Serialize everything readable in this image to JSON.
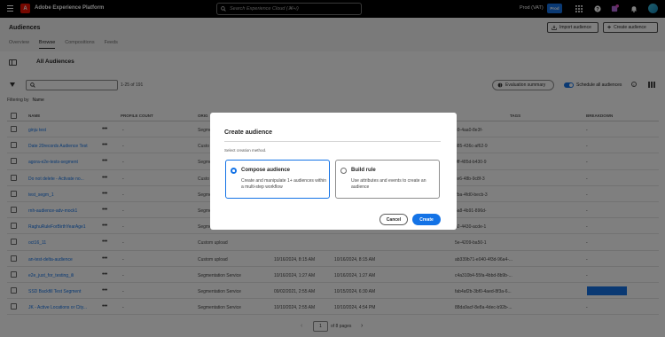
{
  "topbar": {
    "app_title": "Adobe Experience Platform",
    "search_placeholder": "Search Experience Cloud (⌘+/)",
    "org_name": "Prod (VAT)",
    "sandbox": "Prod"
  },
  "header": {
    "title": "Audiences",
    "import_label": "Import audience",
    "create_label": "Create audience",
    "tabs": [
      "Overview",
      "Browse",
      "Compositions",
      "Feeds"
    ],
    "active_tab": "Browse"
  },
  "toolbar": {
    "section_title": "All Audiences",
    "search_value": "",
    "count": "1-25 of 191",
    "eval_label": "Evaluation summary",
    "schedule_label": "Schedule all audiences",
    "filtering_label": "Filtering by",
    "filtering_value": "Name"
  },
  "table": {
    "columns": {
      "name": "NAME",
      "profile_count": "PROFILE COUNT",
      "origin": "ORIG",
      "tags": "TAGS",
      "breakdown": "BREAKDOWN"
    },
    "rows": [
      {
        "name": "ginju test",
        "pc": "-",
        "origin": "Segme",
        "created": "",
        "updated": "",
        "id": "e9-4aa0-8e3f-",
        "bd": "-",
        "bar": false
      },
      {
        "name": "Date 20records Audience Test",
        "pc": "-",
        "origin": "Custo",
        "created": "",
        "updated": "",
        "id": "385-436c-af62-9",
        "bd": "-",
        "bar": false
      },
      {
        "name": "agora-e2e-tests-segment",
        "pc": "-",
        "origin": "Segme",
        "created": "",
        "updated": "",
        "id": "0ff-485d-b430-9",
        "bd": "-",
        "bar": false
      },
      {
        "name": "Do not delete - Activate no...",
        "pc": "-",
        "origin": "Custo",
        "created": "",
        "updated": "",
        "id": "ce6-48b-9c8f-3",
        "bd": "-",
        "bar": false
      },
      {
        "name": "test_segm_1",
        "pc": "-",
        "origin": "Segme",
        "created": "",
        "updated": "",
        "id": "2ba-4fd0-becb-3",
        "bd": "-",
        "bar": false
      },
      {
        "name": "rnh-audience-adv-mock1",
        "pc": "-",
        "origin": "Segme",
        "created": "",
        "updated": "",
        "id": "5a8-4b91-896d-",
        "bd": "-",
        "bar": false
      },
      {
        "name": "RaghuRuleForBirthYearAge1",
        "pc": "-",
        "origin": "Segme",
        "created": "",
        "updated": "",
        "id": "b2-4430-acde-1",
        "bd": "-",
        "bar": false
      },
      {
        "name": "oct16_11",
        "pc": "-",
        "origin": "Custom upload",
        "created": "",
        "updated": "",
        "id": "5e-4209-ba50-1",
        "bd": "-",
        "bar": false
      },
      {
        "name": "an-test-delta-audience",
        "pc": "-",
        "origin": "Custom upload",
        "created": "10/16/2024, 8:15 AM",
        "updated": "10/16/2024, 8:15 AM",
        "id": "ab339b71-e040-4f3d-96a4-...",
        "bd": "-",
        "bar": false
      },
      {
        "name": "e2e_just_for_testing_ili",
        "pc": "-",
        "origin": "Segmentation Service",
        "created": "10/16/2024, 1:27 AM",
        "updated": "10/16/2024, 1:27 AM",
        "id": "c4a310b4-55fa-4bbd-8b9b-...",
        "bd": "-",
        "bar": false
      },
      {
        "name": "SSD Backfill Test Segment",
        "pc": "-",
        "origin": "Segmentation Service",
        "created": "09/02/2021, 2:55 AM",
        "updated": "10/15/2024, 6:30 AM",
        "id": "fab4af2b-3bf0-4aed-8f3a-6...",
        "bd": "",
        "bar": true
      },
      {
        "name": "JK - Active Locations or City...",
        "pc": "-",
        "origin": "Segmentation Service",
        "created": "10/10/2024, 2:55 AM",
        "updated": "10/10/2024, 4:54 PM",
        "id": "88da9acf-8e8a-4dec-b92b-...",
        "bd": "-",
        "bar": false
      }
    ]
  },
  "pager": {
    "current": "1",
    "of_label": "of 8 pages"
  },
  "dialog": {
    "title": "Create audience",
    "subtitle": "Select creation method.",
    "option1_title": "Compose audience",
    "option1_desc": "Create and manipulate 1+ audiences within a multi-step workflow",
    "option2_title": "Build rule",
    "option2_desc": "Use attributes and events to create an audience",
    "cancel_label": "Cancel",
    "create_label": "Create"
  },
  "colors": {
    "accent": "#1473e6",
    "adobe_red": "#eb1000"
  }
}
